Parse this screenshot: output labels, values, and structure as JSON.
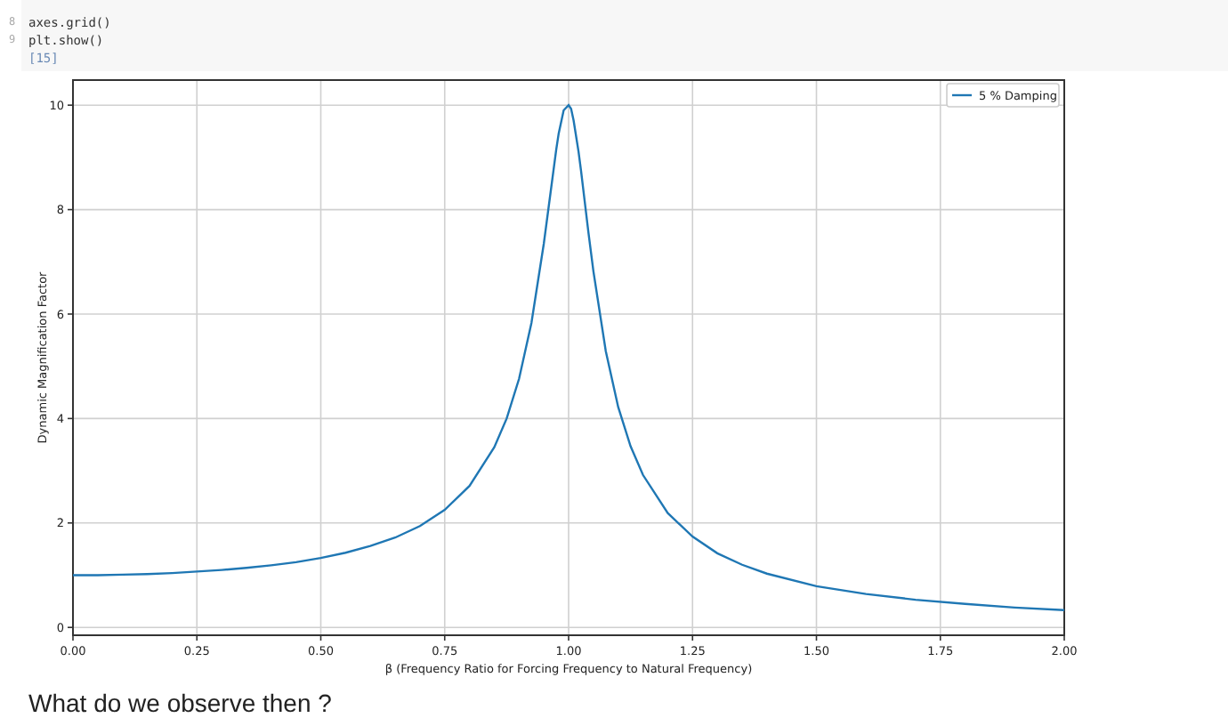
{
  "code_cell": {
    "lines": [
      {
        "number": "8",
        "code": "axes.grid()"
      },
      {
        "number": "9",
        "code": "plt.show()"
      }
    ],
    "execution_count": "[15]"
  },
  "figure": {
    "chart_data": {
      "type": "line",
      "xlabel": "β (Frequency Ratio for Forcing Frequency to Natural Frequency)",
      "ylabel": "Dynamic Magnification Factor",
      "grid": true,
      "x": [
        0,
        0.05,
        0.1,
        0.15,
        0.2,
        0.25,
        0.3,
        0.35,
        0.4,
        0.45,
        0.5,
        0.55,
        0.6,
        0.65,
        0.7,
        0.75,
        0.8,
        0.85,
        0.875,
        0.9,
        0.925,
        0.95,
        0.96,
        0.975,
        0.98,
        0.99,
        1.0,
        1.005,
        1.01,
        1.02,
        1.025,
        1.04,
        1.05,
        1.075,
        1.1,
        1.125,
        1.15,
        1.2,
        1.25,
        1.3,
        1.35,
        1.4,
        1.5,
        1.6,
        1.7,
        1.8,
        1.9,
        2.0
      ],
      "series": [
        {
          "name": "5 % Damping",
          "color": "#1f77b4",
          "values": [
            1,
            1,
            1.01,
            1.02,
            1.04,
            1.07,
            1.1,
            1.14,
            1.19,
            1.25,
            1.33,
            1.43,
            1.56,
            1.72,
            1.94,
            2.25,
            2.71,
            3.45,
            4,
            4.76,
            5.83,
            7.35,
            8.07,
            9.15,
            9.46,
            9.9,
            10,
            9.93,
            9.71,
            9.11,
            8.75,
            7.56,
            6.82,
            5.29,
            4.22,
            3.47,
            2.92,
            2.19,
            1.74,
            1.42,
            1.2,
            1.03,
            0.79,
            0.64,
            0.53,
            0.45,
            0.38,
            0.33
          ]
        }
      ],
      "xlim": [
        0,
        2
      ],
      "ylim": [
        -0.15,
        10.48
      ],
      "xticks": [
        {
          "value": 0,
          "label": "0.00"
        },
        {
          "value": 0.25,
          "label": "0.25"
        },
        {
          "value": 0.5,
          "label": "0.50"
        },
        {
          "value": 0.75,
          "label": "0.75"
        },
        {
          "value": 1,
          "label": "1.00"
        },
        {
          "value": 1.25,
          "label": "1.25"
        },
        {
          "value": 1.5,
          "label": "1.50"
        },
        {
          "value": 1.75,
          "label": "1.75"
        },
        {
          "value": 2,
          "label": "2.00"
        }
      ],
      "yticks": [
        0,
        2,
        4,
        6,
        8,
        10
      ]
    }
  },
  "paragraph": "What do we observe then ?"
}
